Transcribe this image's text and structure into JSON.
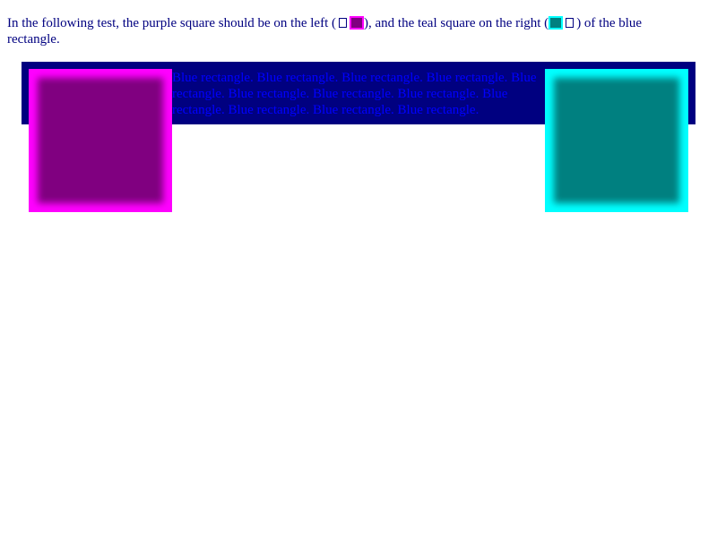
{
  "intro": {
    "part1": "In the following test, the purple square should be on the left (",
    "part2": "), and the teal square on the right (",
    "part3": ") of the blue rectangle."
  },
  "blue_rectangle": {
    "text": "Blue rectangle. Blue rectangle. Blue rectangle. Blue rectangle. Blue rectangle. Blue rectangle. Blue rectangle. Blue rectangle. Blue rectangle. Blue rectangle. Blue rectangle. Blue rectangle."
  },
  "colors": {
    "blue_rectangle": "#000080",
    "blue_text": "#0000ff",
    "purple": "#800080",
    "purple_border": "#ff00ff",
    "teal": "#008080",
    "teal_border": "#00ffff"
  }
}
